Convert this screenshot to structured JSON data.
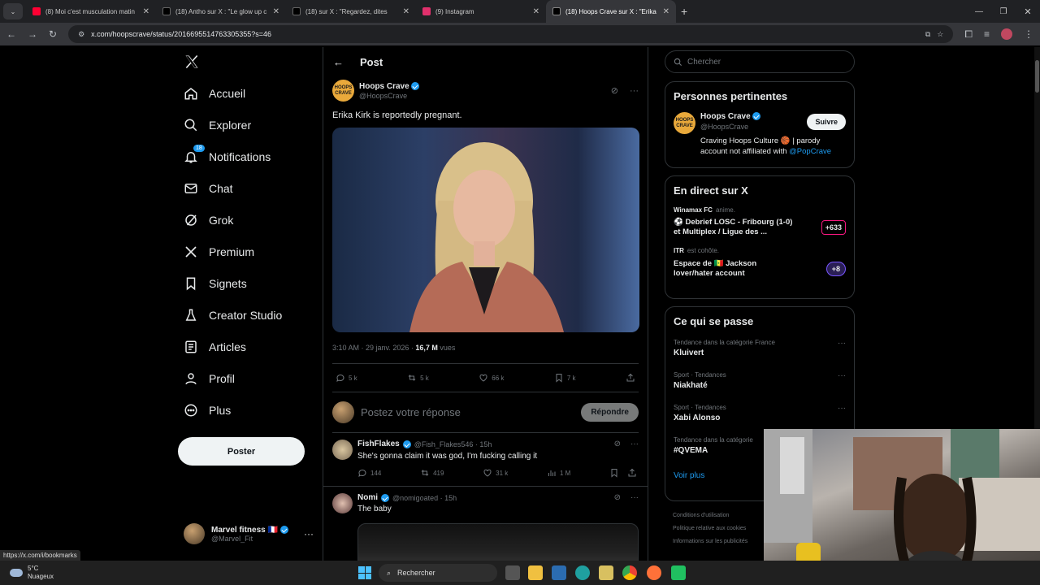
{
  "browser": {
    "tabs": [
      {
        "title": "(8) Moi c'est musculation matin",
        "favicon_color": "#ff0033"
      },
      {
        "title": "(18) Antho sur X : \"Le glow up c",
        "favicon_color": "#000000"
      },
      {
        "title": "(18) sur X : \"Regardez, dites",
        "favicon_color": "#000000"
      },
      {
        "title": "(9) Instagram",
        "favicon_color": "#e1306c"
      },
      {
        "title": "(18) Hoops Crave sur X : \"Erika",
        "favicon_color": "#000000"
      }
    ],
    "url": "x.com/hoopscrave/status/2016695514763305355?s=46",
    "status_url": "https://x.com/i/bookmarks"
  },
  "nav": {
    "items": [
      {
        "label": "Accueil",
        "icon": "home-icon"
      },
      {
        "label": "Explorer",
        "icon": "search-icon"
      },
      {
        "label": "Notifications",
        "icon": "bell-icon",
        "badge": "18"
      },
      {
        "label": "Chat",
        "icon": "mail-icon"
      },
      {
        "label": "Grok",
        "icon": "grok-icon"
      },
      {
        "label": "Premium",
        "icon": "x-logo-icon"
      },
      {
        "label": "Signets",
        "icon": "bookmark-icon"
      },
      {
        "label": "Creator Studio",
        "icon": "flask-icon"
      },
      {
        "label": "Articles",
        "icon": "article-icon"
      },
      {
        "label": "Profil",
        "icon": "person-icon"
      },
      {
        "label": "Plus",
        "icon": "more-circle-icon"
      }
    ],
    "post_button": "Poster",
    "account": {
      "name": "Marvel fitness 🇫🇷",
      "handle": "@Marvel_Fit"
    }
  },
  "post": {
    "header": "Post",
    "author": {
      "name": "Hoops Crave",
      "handle": "@HoopsCrave",
      "avatar_text": "HOOPS CRAVE"
    },
    "text": "Erika Kirk is reportedly pregnant.",
    "time": "3:10 AM · 29 janv. 2026 · ",
    "views": "16,7 M",
    "views_label": " vues",
    "stats": {
      "replies": "5 k",
      "reposts": "5 k",
      "likes": "66 k",
      "bookmarks": "7 k"
    },
    "reply_placeholder": "Postez votre réponse",
    "reply_button": "Répondre"
  },
  "replies": [
    {
      "name": "FishFlakes",
      "handle": "@Fish_Flakes546 · 15h",
      "text": "She's gonna claim it was god, I'm fucking calling it",
      "replies": "144",
      "reposts": "419",
      "likes": "31 k",
      "views": "1 M"
    },
    {
      "name": "Nomi",
      "handle": "@nomigoated · 15h",
      "text": "The baby"
    }
  ],
  "sidebar": {
    "search_placeholder": "Chercher",
    "relevant_title": "Personnes pertinentes",
    "relevant": {
      "name": "Hoops Crave",
      "handle": "@HoopsCrave",
      "bio": "Craving Hoops Culture 🏀 | parody account not affiliated with ",
      "bio_link": "@PopCrave",
      "follow": "Suivre"
    },
    "live_title": "En direct sur X",
    "live": [
      {
        "host": "Winamax FC",
        "hostmeta": "anime.",
        "title": "⚽ Debrief LOSC - Fribourg (1-0) et Multiplex / Ligue des ...",
        "count": "+633",
        "border": "#f91880"
      },
      {
        "host": "ITR",
        "hostmeta": "est cohôte.",
        "title": "Espace de 🇸🇳 Jackson lover/hater account",
        "count": "+8",
        "border": "#7856ff"
      }
    ],
    "trends_title": "Ce qui se passe",
    "trends": [
      {
        "category": "Tendance dans la catégorie France",
        "name": "Kluivert"
      },
      {
        "category": "Sport · Tendances",
        "name": "Niakhaté"
      },
      {
        "category": "Sport · Tendances",
        "name": "Xabi Alonso"
      },
      {
        "category": "Tendance dans la catégorie",
        "name": "#QVEMA"
      }
    ],
    "show_more": "Voir plus",
    "footer": [
      "Conditions d'utilisation",
      "Politique relative aux cookies",
      "Informations sur les publicités"
    ]
  },
  "taskbar": {
    "temp": "5°C",
    "weather": "Nuageux",
    "search": "Rechercher"
  }
}
